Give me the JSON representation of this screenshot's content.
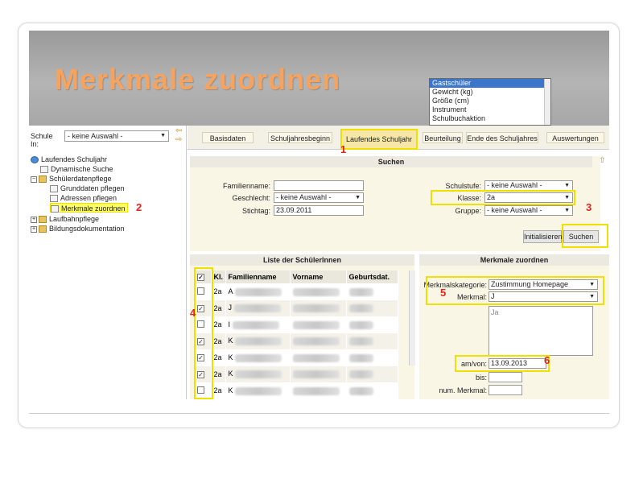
{
  "slide": {
    "title": "Merkmale zuordnen"
  },
  "popup": {
    "items": [
      "Gastschüler",
      "Gewicht (kg)",
      "Größe (cm)",
      "Instrument",
      "Schulbuchaktion"
    ],
    "selected_index": 0
  },
  "left": {
    "school_label": "Schule In:",
    "school_value": "- keine Auswahl -",
    "tree": [
      {
        "label": "Laufendes Schuljahr",
        "icon": "globe-icon"
      },
      {
        "label": "Dynamische Suche",
        "icon": "document-icon"
      },
      {
        "label": "Schülerdatenpflege",
        "icon": "folder-icon"
      },
      {
        "label": "Grunddaten pflegen",
        "icon": "document-icon"
      },
      {
        "label": "Adressen pflegen",
        "icon": "document-icon"
      },
      {
        "label": "Merkmale zuordnen",
        "icon": "document-icon"
      },
      {
        "label": "Laufbahnpflege",
        "icon": "folder-icon"
      },
      {
        "label": "Bildungsdokumentation",
        "icon": "folder-icon"
      }
    ]
  },
  "tabs": [
    "Basisdaten",
    "Schuljahresbeginn",
    "Laufendes Schuljahr",
    "Beurteilung",
    "Ende des Schuljahres",
    "Auswertungen"
  ],
  "active_tab": "Laufendes Schuljahr",
  "search": {
    "header": "Suchen",
    "familienname_label": "Familienname:",
    "familienname_value": "",
    "geschlecht_label": "Geschlecht:",
    "geschlecht_value": "- keine Auswahl -",
    "stichtag_label": "Stichtag:",
    "stichtag_value": "23.09.2011",
    "schulstufe_label": "Schulstufe:",
    "schulstufe_value": "- keine Auswahl -",
    "klasse_label": "Klasse:",
    "klasse_value": "2a",
    "gruppe_label": "Gruppe:",
    "gruppe_value": "- keine Auswahl -",
    "init_button": "Initialisieren",
    "search_button": "Suchen"
  },
  "list": {
    "header": "Liste der SchülerInnen",
    "columns": [
      "Kl.",
      "Familienname",
      "Vorname",
      "Geburtsdat."
    ],
    "rows": [
      {
        "checked": false,
        "kl": "2a",
        "initial": "A"
      },
      {
        "checked": true,
        "kl": "2a",
        "initial": "J"
      },
      {
        "checked": false,
        "kl": "2a",
        "initial": "I"
      },
      {
        "checked": true,
        "kl": "2a",
        "initial": "K"
      },
      {
        "checked": true,
        "kl": "2a",
        "initial": "K"
      },
      {
        "checked": true,
        "kl": "2a",
        "initial": "K"
      },
      {
        "checked": false,
        "kl": "2a",
        "initial": "K"
      }
    ]
  },
  "merkmale": {
    "header": "Merkmale zuordnen",
    "kategorie_label": "Merkmalskategorie:",
    "kategorie_value": "Zustimmung Homepage",
    "merkmal_label": "Merkmal:",
    "merkmal_value": "J",
    "textarea_value": "Ja",
    "amvon_label": "am/von:",
    "amvon_value": "13.09.2013",
    "bis_label": "bis:",
    "bis_value": "",
    "num_label": "num. Merkmal:",
    "num_value": ""
  },
  "markers": [
    "1",
    "2",
    "3",
    "4",
    "5",
    "6"
  ],
  "colors": {
    "title": "#f5a35e",
    "highlight": "#f0e000",
    "marker": "#e0261b"
  }
}
